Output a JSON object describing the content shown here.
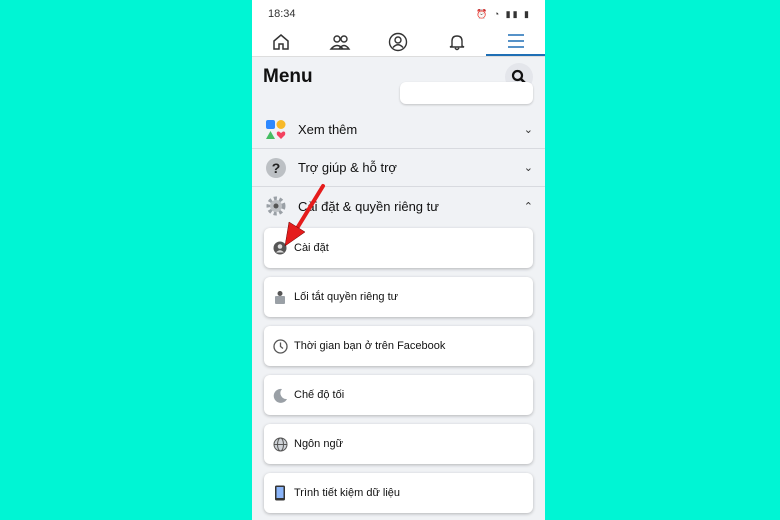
{
  "status_bar": {
    "time": "18:34"
  },
  "nav": {
    "tabs": [
      {
        "icon": "home-icon"
      },
      {
        "icon": "friends-icon"
      },
      {
        "icon": "profile-icon"
      },
      {
        "icon": "bell-icon"
      },
      {
        "icon": "menu-icon",
        "active": true
      }
    ]
  },
  "header": {
    "title": "Menu"
  },
  "sections": [
    {
      "label": "Xem thêm",
      "expanded": false
    },
    {
      "label": "Trợ giúp & hỗ trợ",
      "expanded": false
    },
    {
      "label": "Cài đặt & quyền riêng tư",
      "expanded": true
    }
  ],
  "settings_items": [
    {
      "label": "Cài đặt",
      "icon": "account-icon"
    },
    {
      "label": "Lối tắt quyền riêng tư",
      "icon": "lock-icon"
    },
    {
      "label": "Thời gian bạn ở trên Facebook",
      "icon": "clock-icon"
    },
    {
      "label": "Chế độ tối",
      "icon": "moon-icon"
    },
    {
      "label": "Ngôn ngữ",
      "icon": "globe-icon"
    },
    {
      "label": "Trình tiết kiệm dữ liệu",
      "icon": "phone-icon"
    }
  ],
  "colors": {
    "background": "#00f5d4",
    "accent": "#1f6fb5",
    "arrow": "#e51c1c"
  }
}
